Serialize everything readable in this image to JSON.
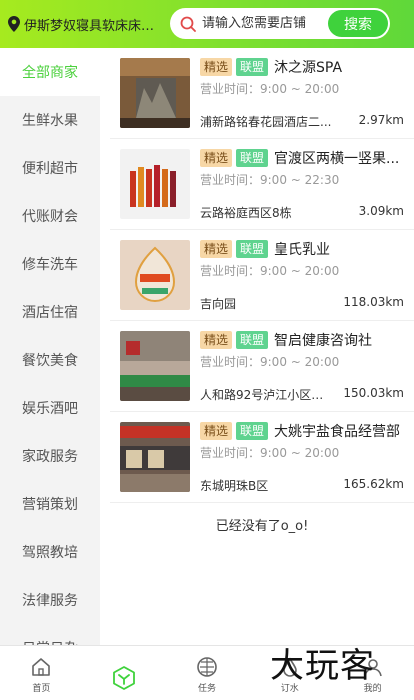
{
  "header": {
    "location": "伊斯梦奴寝具软床床垫...",
    "search_placeholder": "请输入您需要店铺",
    "search_button": "搜索"
  },
  "sidebar": {
    "items": [
      "全部商家",
      "生鲜水果",
      "便利超市",
      "代账财会",
      "修车洗车",
      "酒店住宿",
      "餐饮美食",
      "娱乐酒吧",
      "家政服务",
      "营销策划",
      "驾照教培",
      "法律服务",
      "日常日杂"
    ],
    "active_index": 0
  },
  "shops": [
    {
      "tag1": "精选",
      "tag2": "联盟",
      "name": "沐之源SPA",
      "hours": "营业时间：9:00 ~ 20:00",
      "address": "浦新路铭春花园酒店二...",
      "distance": "2.97km"
    },
    {
      "tag1": "精选",
      "tag2": "联盟",
      "name": "官渡区两横一竖果...",
      "hours": "营业时间：9:00 ~ 22:30",
      "address": "云路裕庭西区8栋",
      "distance": "3.09km"
    },
    {
      "tag1": "精选",
      "tag2": "联盟",
      "name": "皇氏乳业",
      "hours": "营业时间：9:00 ~ 20:00",
      "address": "吉向园",
      "distance": "118.03km"
    },
    {
      "tag1": "精选",
      "tag2": "联盟",
      "name": "智启健康咨询社",
      "hours": "营业时间：9:00 ~ 20:00",
      "address": "人和路92号泸江小区一...",
      "distance": "150.03km"
    },
    {
      "tag1": "精选",
      "tag2": "联盟",
      "name": "大姚宇盐食品经营部",
      "hours": "营业时间：9:00 ~ 20:00",
      "address": "东城明珠B区",
      "distance": "165.62km"
    }
  ],
  "end_text": "已经没有了o_o!",
  "tabbar": {
    "items": [
      {
        "label": "首页",
        "icon": "home-icon"
      },
      {
        "label": "",
        "icon": "cube-icon"
      },
      {
        "label": "任务",
        "icon": "globe-icon"
      },
      {
        "label": "订水",
        "icon": "water-icon"
      },
      {
        "label": "我的",
        "icon": "user-icon"
      }
    ]
  },
  "watermark": "大玩客",
  "colors": {
    "accent": "#4bd03c",
    "header_start": "#a6ea1f",
    "header_end": "#5fd83a",
    "tag_select": "#f7d7a6",
    "tag_member": "#5fd38f"
  }
}
